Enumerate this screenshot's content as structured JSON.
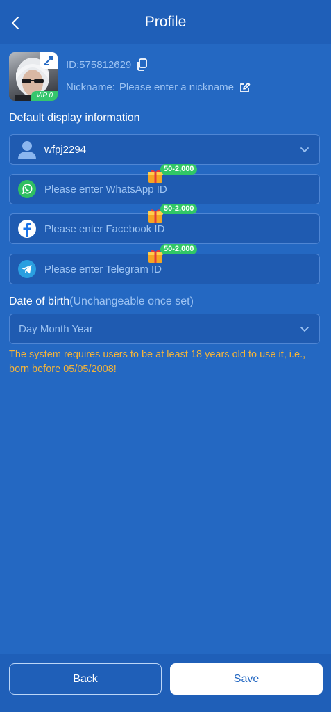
{
  "header": {
    "title": "Profile"
  },
  "profile": {
    "id_label": "ID:575812629",
    "nickname_label": "Nickname:",
    "nickname_placeholder": "Please enter a nickname",
    "vip_label": "VIP 0"
  },
  "default_display": {
    "heading": "Default display information",
    "username": "wfpj2294"
  },
  "socials": [
    {
      "placeholder": "Please enter WhatsApp ID",
      "reward": "50-2,000",
      "icon": "whatsapp-icon"
    },
    {
      "placeholder": "Please enter Facebook ID",
      "reward": "50-2,000",
      "icon": "facebook-icon"
    },
    {
      "placeholder": "Please enter Telegram ID",
      "reward": "50-2,000",
      "icon": "telegram-icon"
    }
  ],
  "birth": {
    "heading": "Date of birth",
    "heading_note": "(Unchangeable once set)",
    "placeholder": "Day Month Year",
    "notice": "The system requires users to be at least 18 years old to use it, i.e., born before 05/05/2008!"
  },
  "footer": {
    "back_label": "Back",
    "save_label": "Save"
  },
  "colors": {
    "background": "#2468c2",
    "field": "#1f5bb1",
    "reward": "#31c766",
    "notice": "#f4b43a",
    "muted": "#9ec4f3"
  }
}
